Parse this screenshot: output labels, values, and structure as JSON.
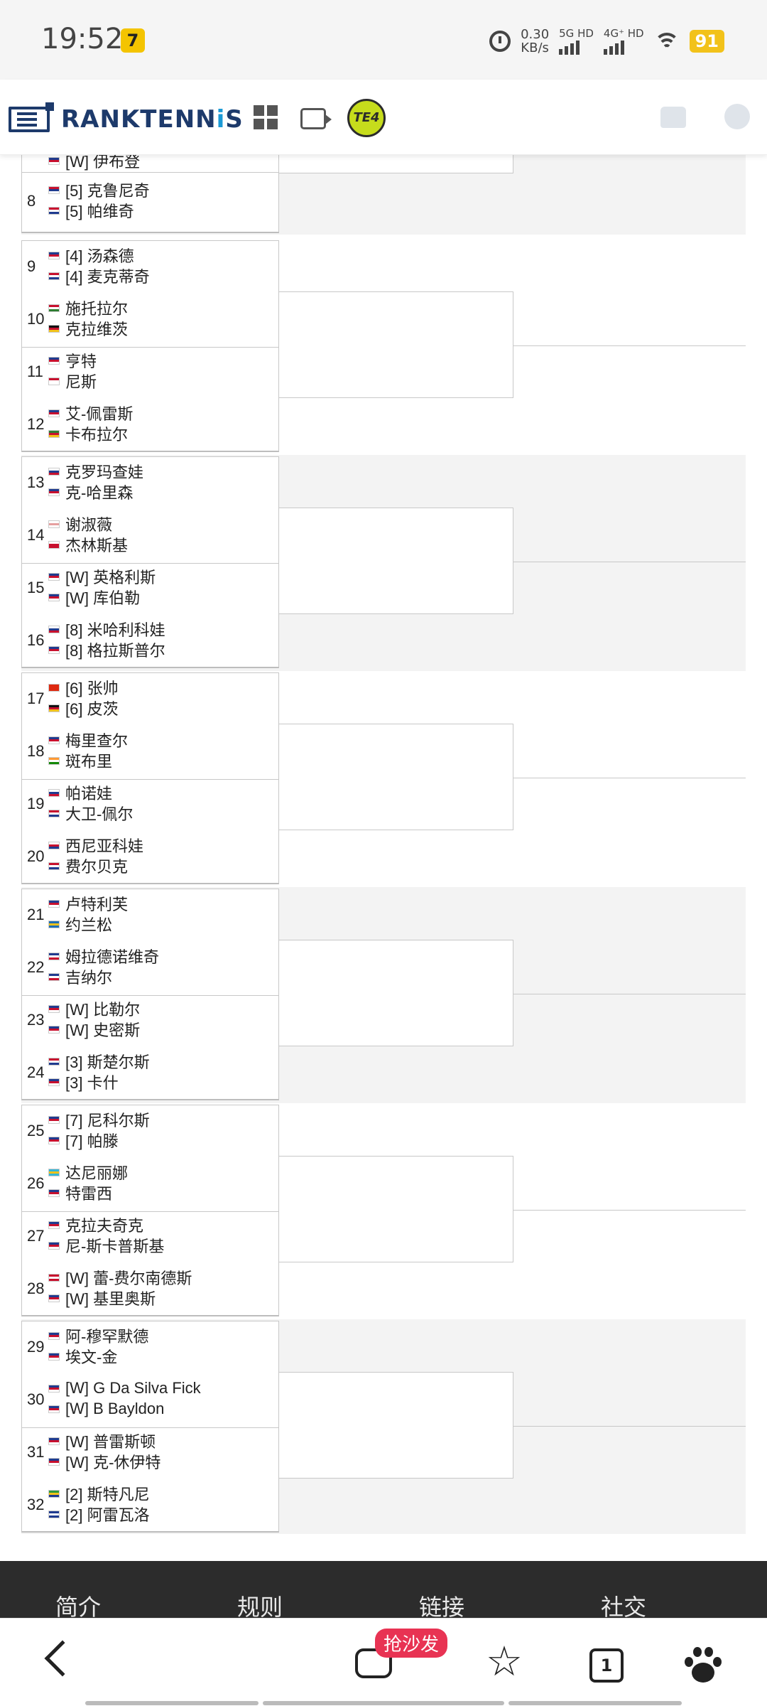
{
  "status_bar": {
    "time": "19:52",
    "app_icon": "7",
    "speed_value": "0.30",
    "speed_unit": "KB/s",
    "net1": "5G HD",
    "net2": "4G⁺ HD",
    "battery": "91"
  },
  "header": {
    "logo_main": "RANKTENN",
    "logo_accent": "i",
    "logo_end": "S",
    "badge": "TE4",
    "icons": [
      "grid-icon",
      "video-icon",
      "shirt-icon",
      "globe-icon"
    ]
  },
  "partial_row": {
    "player": "[W] 伊布登",
    "flag_colors": [
      "#1f3b8f",
      "#c8102e"
    ]
  },
  "matches": [
    {
      "num": "8",
      "p1": "[5] 克鲁尼奇",
      "f1": [
        "#c8102e",
        "#1f3b8f",
        "#ffffff"
      ],
      "p2": "[5] 帕维奇",
      "f2": [
        "#c8102e",
        "#ffffff",
        "#1f3b8f"
      ]
    },
    {
      "num": "9",
      "p1": "[4] 汤森德",
      "f1": [
        "#1f3b8f",
        "#c8102e",
        "#ffffff"
      ],
      "p2": "[4] 麦克蒂奇",
      "f2": [
        "#c8102e",
        "#ffffff",
        "#1f3b8f"
      ]
    },
    {
      "num": "10",
      "p1": "施托拉尔",
      "f1": [
        "#c8102e",
        "#ffffff",
        "#2e7d32"
      ],
      "p2": "克拉维茨",
      "f2": [
        "#111111",
        "#c8102e",
        "#f2c21a"
      ]
    },
    {
      "num": "11",
      "p1": "亨特",
      "f1": [
        "#1f3b8f",
        "#c8102e",
        "#ffffff"
      ],
      "p2": "尼斯",
      "f2": [
        "#c8102e",
        "#ffffff",
        "#ffffff"
      ]
    },
    {
      "num": "12",
      "p1": "艾-佩雷斯",
      "f1": [
        "#1f3b8f",
        "#c8102e",
        "#ffffff"
      ],
      "p2": "卡布拉尔",
      "f2": [
        "#2e7d32",
        "#c8102e",
        "#f2c21a"
      ]
    },
    {
      "num": "13",
      "p1": "克罗玛查娃",
      "f1": [
        "#ffffff",
        "#1f3b8f",
        "#c8102e"
      ],
      "p2": "克-哈里森",
      "f2": [
        "#1f3b8f",
        "#c8102e",
        "#ffffff"
      ]
    },
    {
      "num": "14",
      "p1": "谢淑薇",
      "f1": [
        "#ffffff",
        "#e6a0a0",
        "#ffffff"
      ],
      "p2": "杰林斯基",
      "f2": [
        "#ffffff",
        "#c8102e",
        "#c8102e"
      ]
    },
    {
      "num": "15",
      "p1": "[W] 英格利斯",
      "f1": [
        "#1f3b8f",
        "#c8102e",
        "#ffffff"
      ],
      "p2": "[W] 库伯勒",
      "f2": [
        "#1f3b8f",
        "#c8102e",
        "#ffffff"
      ]
    },
    {
      "num": "16",
      "p1": "[8] 米哈利科娃",
      "f1": [
        "#ffffff",
        "#1f3b8f",
        "#c8102e"
      ],
      "p2": "[8] 格拉斯普尔",
      "f2": [
        "#1f3b8f",
        "#c8102e",
        "#ffffff"
      ]
    },
    {
      "num": "17",
      "p1": "[6] 张帅",
      "f1": [
        "#de2910",
        "#de2910",
        "#de2910"
      ],
      "p2": "[6] 皮茨",
      "f2": [
        "#111111",
        "#c8102e",
        "#f2c21a"
      ]
    },
    {
      "num": "18",
      "p1": "梅里查尔",
      "f1": [
        "#1f3b8f",
        "#c8102e",
        "#ffffff"
      ],
      "p2": "斑布里",
      "f2": [
        "#ff9933",
        "#ffffff",
        "#138808"
      ]
    },
    {
      "num": "19",
      "p1": "帕诺娃",
      "f1": [
        "#ffffff",
        "#1f3b8f",
        "#c8102e"
      ],
      "p2": "大卫-佩尔",
      "f2": [
        "#c8102e",
        "#ffffff",
        "#1f3b8f"
      ]
    },
    {
      "num": "20",
      "p1": "西尼亚科娃",
      "f1": [
        "#ffffff",
        "#c8102e",
        "#1f3b8f"
      ],
      "p2": "费尔贝克",
      "f2": [
        "#c8102e",
        "#ffffff",
        "#1f3b8f"
      ]
    },
    {
      "num": "21",
      "p1": "卢特利芙",
      "f1": [
        "#1f3b8f",
        "#c8102e",
        "#ffffff"
      ],
      "p2": "约兰松",
      "f2": [
        "#1f6fb5",
        "#f2c21a",
        "#1f6fb5"
      ]
    },
    {
      "num": "22",
      "p1": "姆拉德诺维奇",
      "f1": [
        "#1f3b8f",
        "#ffffff",
        "#c8102e"
      ],
      "p2": "吉纳尔",
      "f2": [
        "#1f3b8f",
        "#ffffff",
        "#c8102e"
      ]
    },
    {
      "num": "23",
      "p1": "[W] 比勒尔",
      "f1": [
        "#1f3b8f",
        "#c8102e",
        "#ffffff"
      ],
      "p2": "[W] 史密斯",
      "f2": [
        "#1f3b8f",
        "#c8102e",
        "#ffffff"
      ]
    },
    {
      "num": "24",
      "p1": "[3] 斯楚尔斯",
      "f1": [
        "#c8102e",
        "#ffffff",
        "#1f3b8f"
      ],
      "p2": "[3] 卡什",
      "f2": [
        "#1f3b8f",
        "#c8102e",
        "#ffffff"
      ]
    },
    {
      "num": "25",
      "p1": "[7] 尼科尔斯",
      "f1": [
        "#1f3b8f",
        "#c8102e",
        "#ffffff"
      ],
      "p2": "[7] 帕滕",
      "f2": [
        "#1f3b8f",
        "#c8102e",
        "#ffffff"
      ]
    },
    {
      "num": "26",
      "p1": "达尼丽娜",
      "f1": [
        "#35b6d6",
        "#f2c21a",
        "#35b6d6"
      ],
      "p2": "特雷西",
      "f2": [
        "#1f3b8f",
        "#c8102e",
        "#ffffff"
      ]
    },
    {
      "num": "27",
      "p1": "克拉夫奇克",
      "f1": [
        "#1f3b8f",
        "#c8102e",
        "#ffffff"
      ],
      "p2": "尼-斯卡普斯基",
      "f2": [
        "#1f3b8f",
        "#c8102e",
        "#ffffff"
      ]
    },
    {
      "num": "28",
      "p1": "[W] 蕾-费尔南德斯",
      "f1": [
        "#c8102e",
        "#ffffff",
        "#c8102e"
      ],
      "p2": "[W] 基里奥斯",
      "f2": [
        "#1f3b8f",
        "#c8102e",
        "#ffffff"
      ]
    },
    {
      "num": "29",
      "p1": "阿-穆罕默德",
      "f1": [
        "#1f3b8f",
        "#c8102e",
        "#ffffff"
      ],
      "p2": "埃文-金",
      "f2": [
        "#1f3b8f",
        "#c8102e",
        "#ffffff"
      ]
    },
    {
      "num": "30",
      "p1": "[W] G Da Silva Fick",
      "f1": [
        "#1f3b8f",
        "#c8102e",
        "#ffffff"
      ],
      "p2": "[W] B Bayldon",
      "f2": [
        "#1f3b8f",
        "#c8102e",
        "#ffffff"
      ]
    },
    {
      "num": "31",
      "p1": "[W] 普雷斯顿",
      "f1": [
        "#1f3b8f",
        "#c8102e",
        "#ffffff"
      ],
      "p2": "[W] 克-休伊特",
      "f2": [
        "#1f3b8f",
        "#c8102e",
        "#ffffff"
      ]
    },
    {
      "num": "32",
      "p1": "[2] 斯特凡尼",
      "f1": [
        "#2e9a3c",
        "#f2c21a",
        "#1f3b8f"
      ],
      "p2": "[2] 阿雷瓦洛",
      "f2": [
        "#1f3b8f",
        "#ffffff",
        "#1f3b8f"
      ]
    }
  ],
  "footer": {
    "items": [
      "简介",
      "规则",
      "链接",
      "社交"
    ]
  },
  "bottom_nav": {
    "sofa_badge": "抢沙发",
    "tabs_count": "1"
  }
}
